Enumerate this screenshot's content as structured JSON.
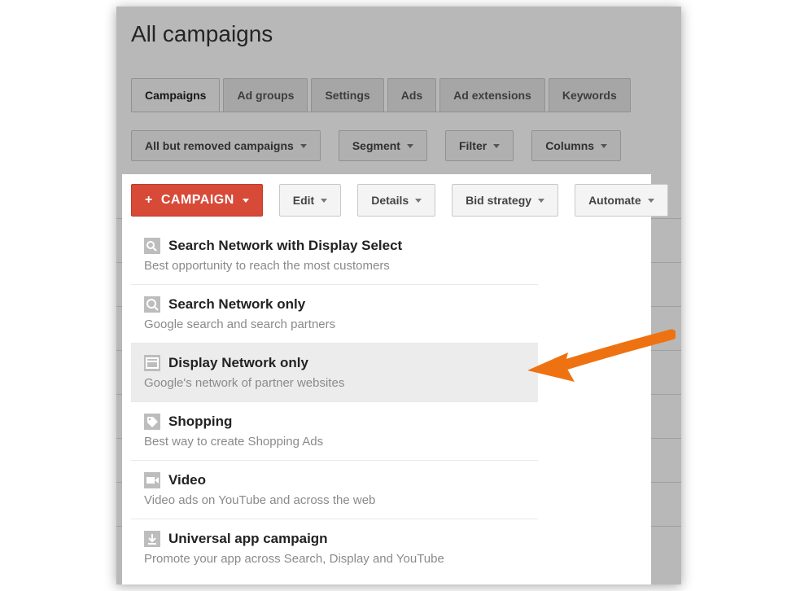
{
  "page": {
    "title": "All campaigns"
  },
  "tabs": [
    {
      "label": "Campaigns",
      "active": true
    },
    {
      "label": "Ad groups"
    },
    {
      "label": "Settings"
    },
    {
      "label": "Ads"
    },
    {
      "label": "Ad extensions"
    },
    {
      "label": "Keywords"
    }
  ],
  "filters": {
    "scope": "All but removed campaigns",
    "segment": "Segment",
    "filter": "Filter",
    "columns": "Columns"
  },
  "actions": {
    "campaign": "CAMPAIGN",
    "edit": "Edit",
    "details": "Details",
    "bid": "Bid strategy",
    "automate": "Automate"
  },
  "dropdown": [
    {
      "icon": "search-display-icon",
      "title": "Search Network with Display Select",
      "sub": "Best opportunity to reach the most customers"
    },
    {
      "icon": "search-icon",
      "title": "Search Network only",
      "sub": "Google search and search partners"
    },
    {
      "icon": "display-icon",
      "title": "Display Network only",
      "sub": "Google's network of partner websites",
      "highlight": true
    },
    {
      "icon": "tag-icon",
      "title": "Shopping",
      "sub": "Best way to create Shopping Ads"
    },
    {
      "icon": "video-icon",
      "title": "Video",
      "sub": "Video ads on YouTube and across the web"
    },
    {
      "icon": "download-icon",
      "title": "Universal app campaign",
      "sub": "Promote your app across Search, Display and YouTube"
    }
  ],
  "colors": {
    "accent_red": "#d84a38",
    "arrow": "#ee7211"
  }
}
